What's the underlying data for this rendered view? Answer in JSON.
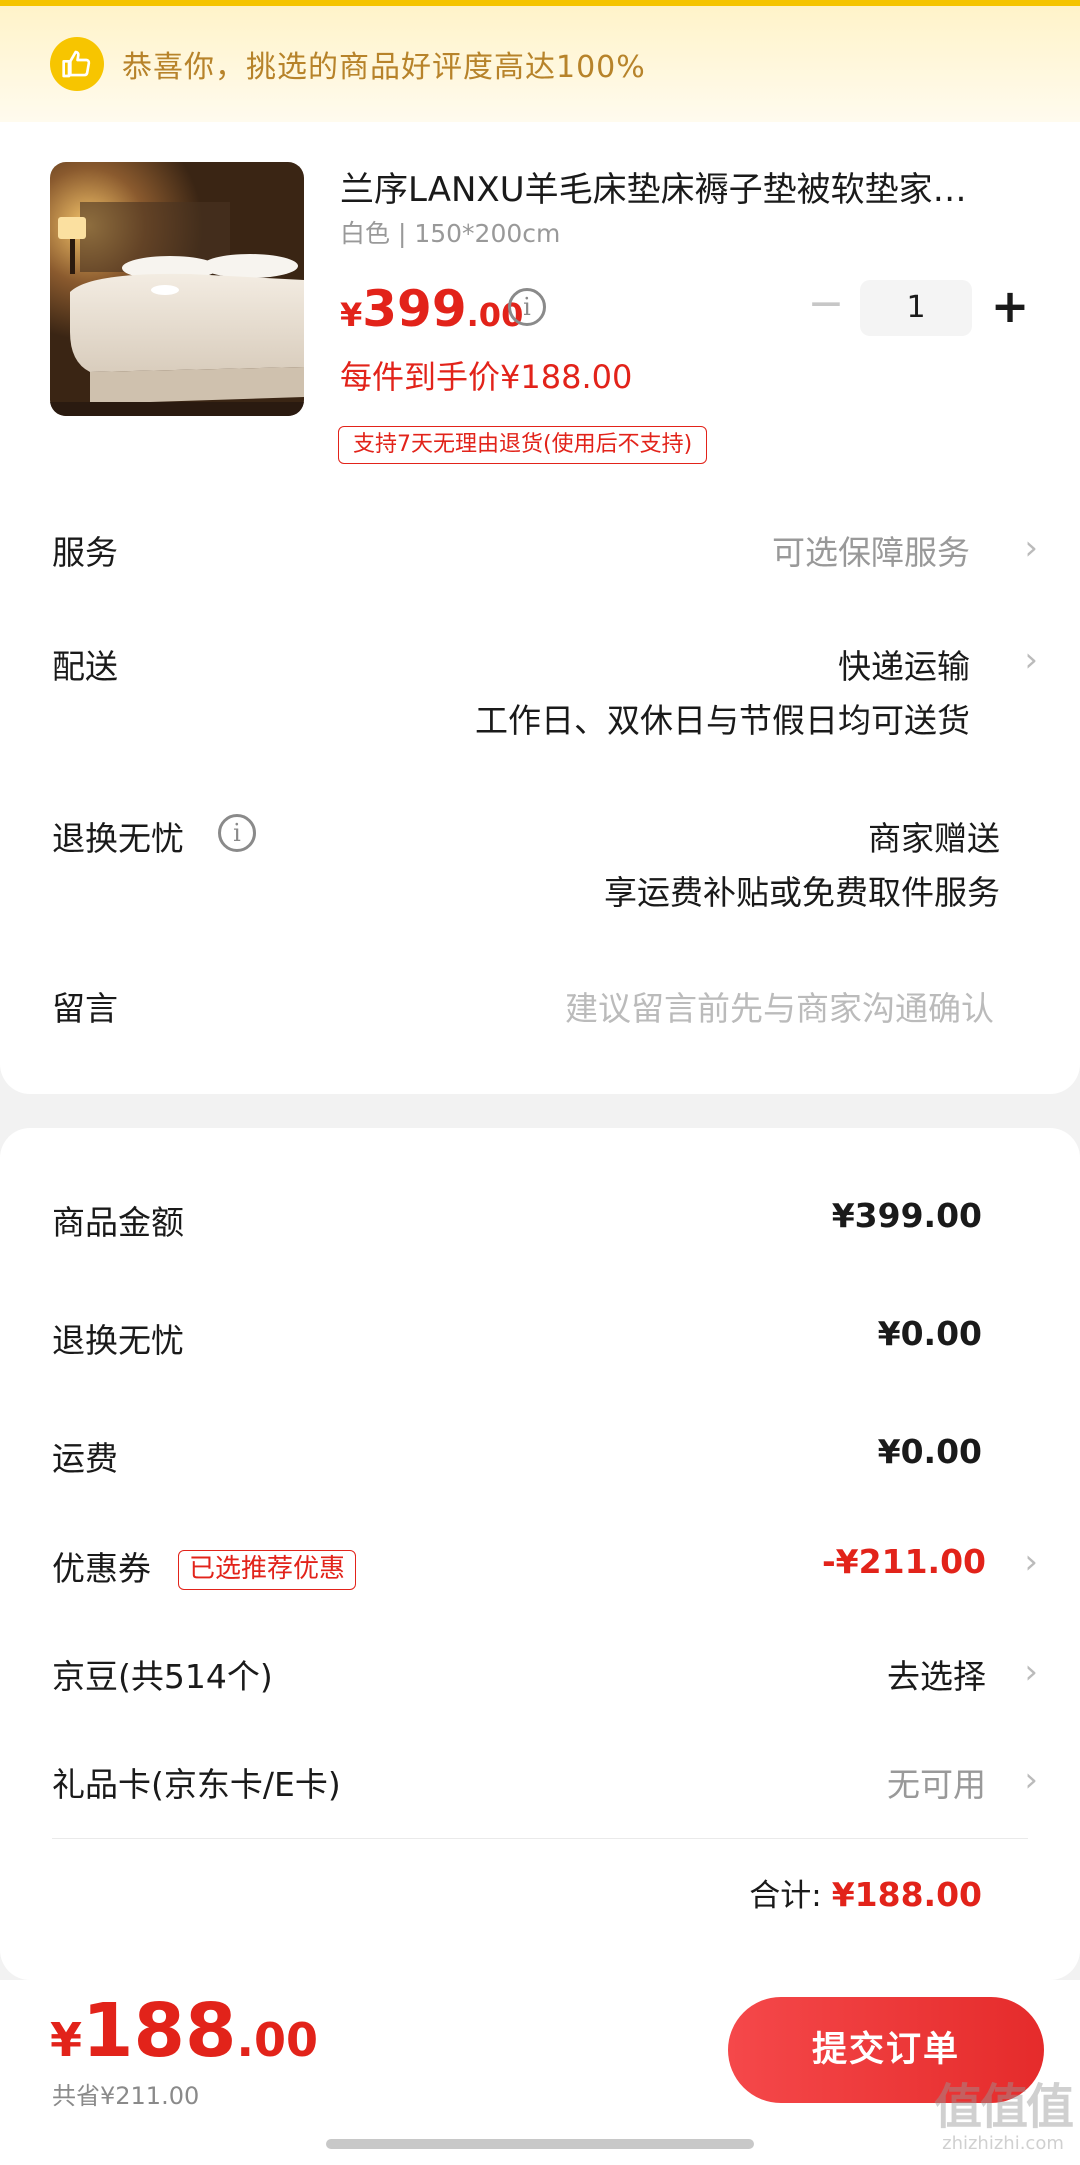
{
  "banner": {
    "text": "恭喜你，挑选的商品好评度高达100%",
    "icon": "thumbs-up-icon"
  },
  "product": {
    "title": "兰序LANXU羊毛床垫床褥子垫被软垫家…",
    "spec": "白色 | 150*200cm",
    "price_yen": "¥",
    "price_int": "399",
    "price_dec": ".00",
    "quantity": "1",
    "hand_price": "每件到手价¥188.00",
    "return_tag": "支持7天无理由退货(使用后不支持)"
  },
  "rows": {
    "service_label": "服务",
    "service_value": "可选保障服务",
    "delivery_label": "配送",
    "delivery_value": "快递运输",
    "delivery_sub": "工作日、双休日与节假日均可送货",
    "worry_label": "退换无忧",
    "worry_value": "商家赠送",
    "worry_sub": "享运费补贴或免费取件服务",
    "note_label": "留言",
    "note_placeholder": "建议留言前先与商家沟通确认"
  },
  "summary": {
    "goods_label": "商品金额",
    "goods_value": "¥399.00",
    "worry_label": "退换无忧",
    "worry_value": "¥0.00",
    "shipping_label": "运费",
    "shipping_value": "¥0.00",
    "coupon_label": "优惠券",
    "coupon_tag": "已选推荐优惠",
    "coupon_value": "-¥211.00",
    "beans_label": "京豆(共514个)",
    "beans_value": "去选择",
    "gift_label": "礼品卡(京东卡/E卡)",
    "gift_value": "无可用",
    "total_label": "合计:",
    "total_value": "¥188.00"
  },
  "footer": {
    "price_yen": "¥",
    "price_int": "188",
    "price_dec": ".00",
    "saved": "共省¥211.00",
    "submit_label": "提交订单"
  },
  "watermark": {
    "logo": "值值值",
    "url": "zhizhizhi.com"
  },
  "colors": {
    "accent": "#e2231a",
    "banner_text": "#b7832a",
    "banner_icon": "#f7c500",
    "submit_gradient_start": "#f5484a",
    "submit_gradient_end": "#e52b2b"
  }
}
